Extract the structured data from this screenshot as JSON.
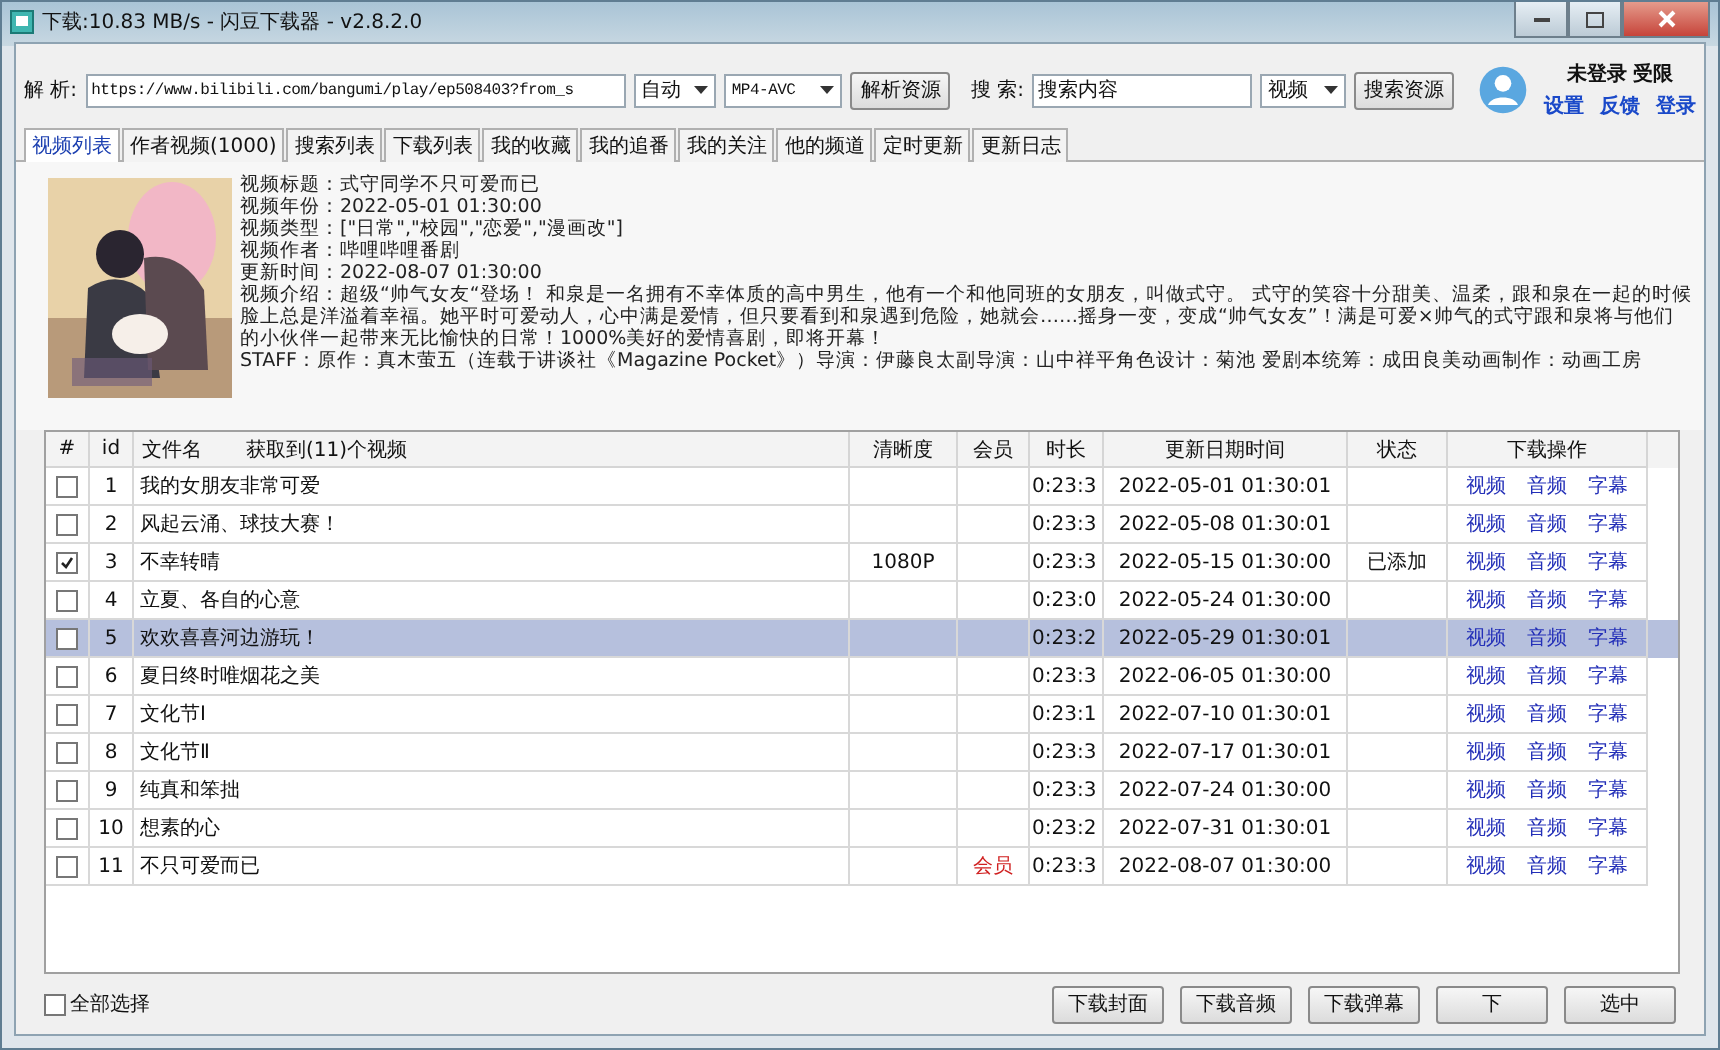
{
  "window": {
    "title": "下载:10.83 MB/s - 闪豆下载器 - v2.8.2.0"
  },
  "parse": {
    "label": "解 析:",
    "value": "https://www.bilibili.com/bangumi/play/ep508403?from_s",
    "mode": "自动",
    "format": "MP4-AVC",
    "button": "解析资源"
  },
  "search": {
    "label": "搜 索:",
    "value": "搜索内容",
    "type": "视频",
    "button": "搜索资源"
  },
  "user": {
    "status": "未登录 受限",
    "links": [
      "设置",
      "反馈",
      "登录"
    ]
  },
  "tabs": [
    {
      "label": "视频列表",
      "selected": true
    },
    {
      "label": "作者视频(1000)",
      "selected": false
    },
    {
      "label": "搜索列表",
      "selected": false
    },
    {
      "label": "下载列表",
      "selected": false
    },
    {
      "label": "我的收藏",
      "selected": false
    },
    {
      "label": "我的追番",
      "selected": false
    },
    {
      "label": "我的关注",
      "selected": false
    },
    {
      "label": "他的频道",
      "selected": false
    },
    {
      "label": "定时更新",
      "selected": false
    },
    {
      "label": "更新日志",
      "selected": false
    }
  ],
  "info": {
    "lines": [
      "视频标题：式守同学不只可爱而已",
      "视频年份：2022-05-01 01:30:00",
      "视频类型：[\"日常\",\"校园\",\"恋爱\",\"漫画改\"]",
      "视频作者：哔哩哔哩番剧",
      "更新时间：2022-08-07 01:30:00",
      "视频介绍：超级“帅气女友“登场！ 和泉是一名拥有不幸体质的高中男生，他有一个和他同班的女朋友，叫做式守。 式守的笑容十分甜美、温柔，跟和泉在一起的时候脸上总是洋溢着幸福。她平时可爱动人，心中满是爱情，但只要看到和泉遇到危险，她就会……摇身一变，变成“帅气女友”！满是可爱×帅气的式守跟和泉将与他们的小伙伴一起带来无比愉快的日常！1000%美好的爱情喜剧，即将开幕！",
      "STAFF：原作：真木萤五（连载于讲谈社《Magazine Pocket》）导演：伊藤良太副导演：山中祥平角色设计：菊池 爱剧本统筹：成田良美动画制作：动画工房"
    ]
  },
  "table": {
    "columns": [
      "#",
      "id",
      "文件名",
      "清晰度",
      "会员",
      "时长",
      "更新日期时间",
      "状态",
      "下载操作"
    ],
    "count_label": "获取到(11)个视频",
    "rows": [
      {
        "id": "1",
        "name": "我的女朋友非常可爱",
        "quality": "",
        "vip": "",
        "duration": "0:23:3",
        "date": "2022-05-01 01:30:01",
        "status": "",
        "checked": false,
        "selected": false,
        "actions": [
          "视频",
          "音频",
          "字幕"
        ]
      },
      {
        "id": "2",
        "name": "风起云涌、球技大赛！",
        "quality": "",
        "vip": "",
        "duration": "0:23:3",
        "date": "2022-05-08 01:30:01",
        "status": "",
        "checked": false,
        "selected": false,
        "actions": [
          "视频",
          "音频",
          "字幕"
        ]
      },
      {
        "id": "3",
        "name": "不幸转晴",
        "quality": "1080P",
        "vip": "",
        "duration": "0:23:3",
        "date": "2022-05-15 01:30:00",
        "status": "已添加",
        "checked": true,
        "selected": false,
        "actions": [
          "视频",
          "音频",
          "字幕"
        ]
      },
      {
        "id": "4",
        "name": "立夏、各自的心意",
        "quality": "",
        "vip": "",
        "duration": "0:23:0",
        "date": "2022-05-24 01:30:00",
        "status": "",
        "checked": false,
        "selected": false,
        "actions": [
          "视频",
          "音频",
          "字幕"
        ]
      },
      {
        "id": "5",
        "name": "欢欢喜喜河边游玩！",
        "quality": "",
        "vip": "",
        "duration": "0:23:2",
        "date": "2022-05-29 01:30:01",
        "status": "",
        "checked": false,
        "selected": true,
        "actions": [
          "视频",
          "音频",
          "字幕"
        ]
      },
      {
        "id": "6",
        "name": "夏日终时唯烟花之美",
        "quality": "",
        "vip": "",
        "duration": "0:23:3",
        "date": "2022-06-05 01:30:00",
        "status": "",
        "checked": false,
        "selected": false,
        "actions": [
          "视频",
          "音频",
          "字幕"
        ]
      },
      {
        "id": "7",
        "name": "文化节Ⅰ",
        "quality": "",
        "vip": "",
        "duration": "0:23:1",
        "date": "2022-07-10 01:30:01",
        "status": "",
        "checked": false,
        "selected": false,
        "actions": [
          "视频",
          "音频",
          "字幕"
        ]
      },
      {
        "id": "8",
        "name": "文化节Ⅱ",
        "quality": "",
        "vip": "",
        "duration": "0:23:3",
        "date": "2022-07-17 01:30:01",
        "status": "",
        "checked": false,
        "selected": false,
        "actions": [
          "视频",
          "音频",
          "字幕"
        ]
      },
      {
        "id": "9",
        "name": "纯真和笨拙",
        "quality": "",
        "vip": "",
        "duration": "0:23:3",
        "date": "2022-07-24 01:30:00",
        "status": "",
        "checked": false,
        "selected": false,
        "actions": [
          "视频",
          "音频",
          "字幕"
        ]
      },
      {
        "id": "10",
        "name": "想素的心",
        "quality": "",
        "vip": "",
        "duration": "0:23:2",
        "date": "2022-07-31 01:30:01",
        "status": "",
        "checked": false,
        "selected": false,
        "actions": [
          "视频",
          "音频",
          "字幕"
        ]
      },
      {
        "id": "11",
        "name": "不只可爱而已",
        "quality": "",
        "vip": "会员",
        "duration": "0:23:3",
        "date": "2022-08-07 01:30:00",
        "status": "",
        "checked": false,
        "selected": false,
        "actions": [
          "视频",
          "音频",
          "字幕"
        ]
      }
    ]
  },
  "footer": {
    "select_all": {
      "label": "全部选择",
      "checked": false
    },
    "buttons": [
      "下载封面",
      "下载音频",
      "下载弹幕",
      "下",
      "选中"
    ]
  }
}
